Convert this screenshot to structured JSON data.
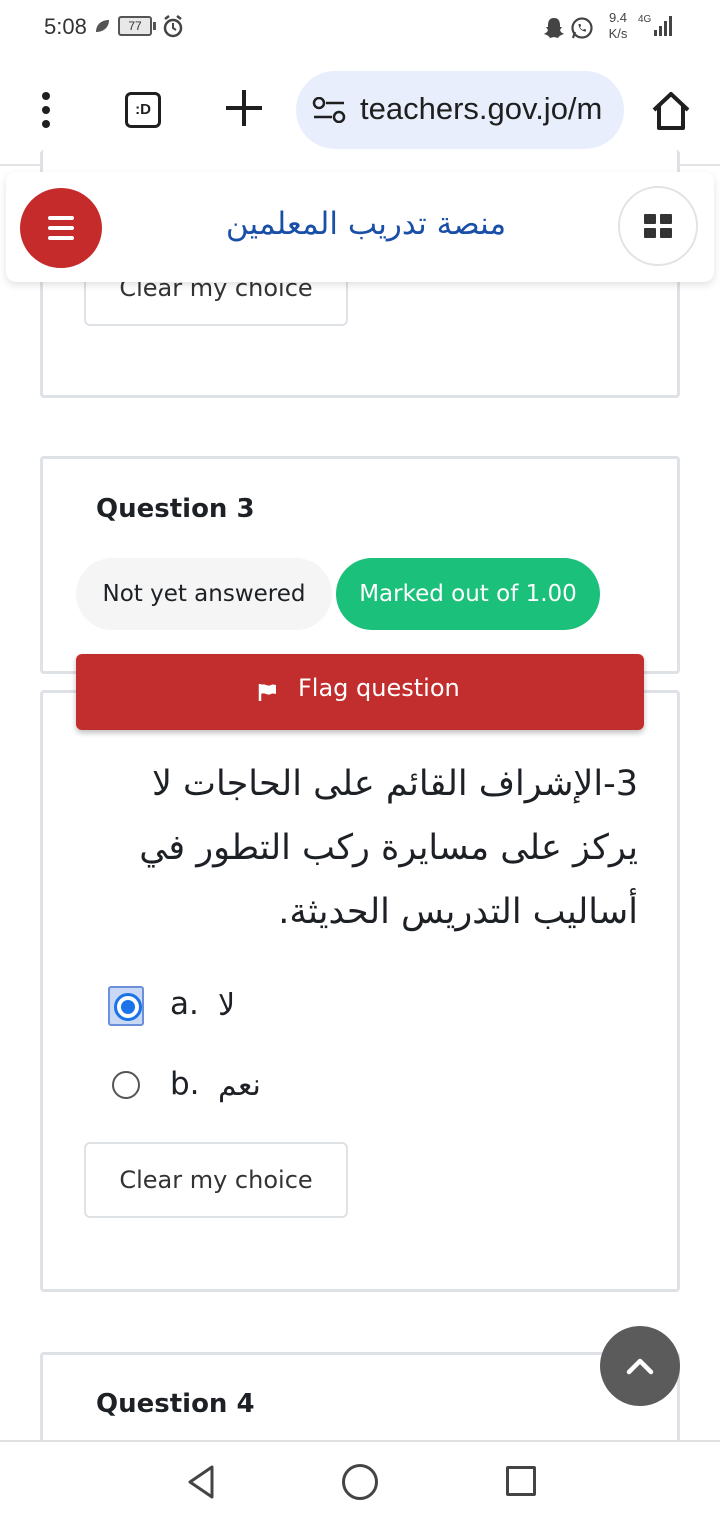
{
  "status_bar": {
    "time": "5:08",
    "battery": "77",
    "net_speed_value": "9.4",
    "net_speed_unit": "K/s",
    "network": "4G",
    "icons": [
      "leaf-icon",
      "battery-icon",
      "alarm-icon",
      "snapchat-icon",
      "whatsapp-icon",
      "signal-icon"
    ]
  },
  "browser": {
    "tabs_label": ":D",
    "url": "teachers.gov.jo/m",
    "icons": [
      "menu-dots-icon",
      "tabs-icon",
      "new-tab-plus-icon",
      "site-settings-icon",
      "home-icon"
    ]
  },
  "site_header": {
    "title": "منصة تدريب المعلمين",
    "icons": [
      "hamburger-menu-icon",
      "apps-grid-icon"
    ],
    "accent_color": "#c62b2b",
    "title_color": "#1a4fa8"
  },
  "previous_question": {
    "clear_label": "Clear my choice"
  },
  "question3": {
    "title": "Question 3",
    "status": "Not yet answered",
    "marks": "Marked out of 1.00",
    "flag_label": "Flag question",
    "text": "3-الإشراف القائم على الحاجات لا يركز على مسايرة ركب التطور في أساليب التدريس الحديثة.",
    "options": [
      {
        "letter": "a.",
        "text": "لا",
        "selected": true
      },
      {
        "letter": "b.",
        "text": "نعم",
        "selected": false
      }
    ],
    "clear_label": "Clear my choice",
    "colors": {
      "marks_badge": "#1bc07a",
      "flag_button": "#c22d2d",
      "radio_selected": "#1a73e8"
    }
  },
  "question4": {
    "title": "Question 4"
  },
  "nav_bar": {
    "icons": [
      "back-triangle-icon",
      "home-circle-icon",
      "recents-square-icon"
    ]
  },
  "back_to_top": {
    "icon": "chevron-up-icon"
  }
}
